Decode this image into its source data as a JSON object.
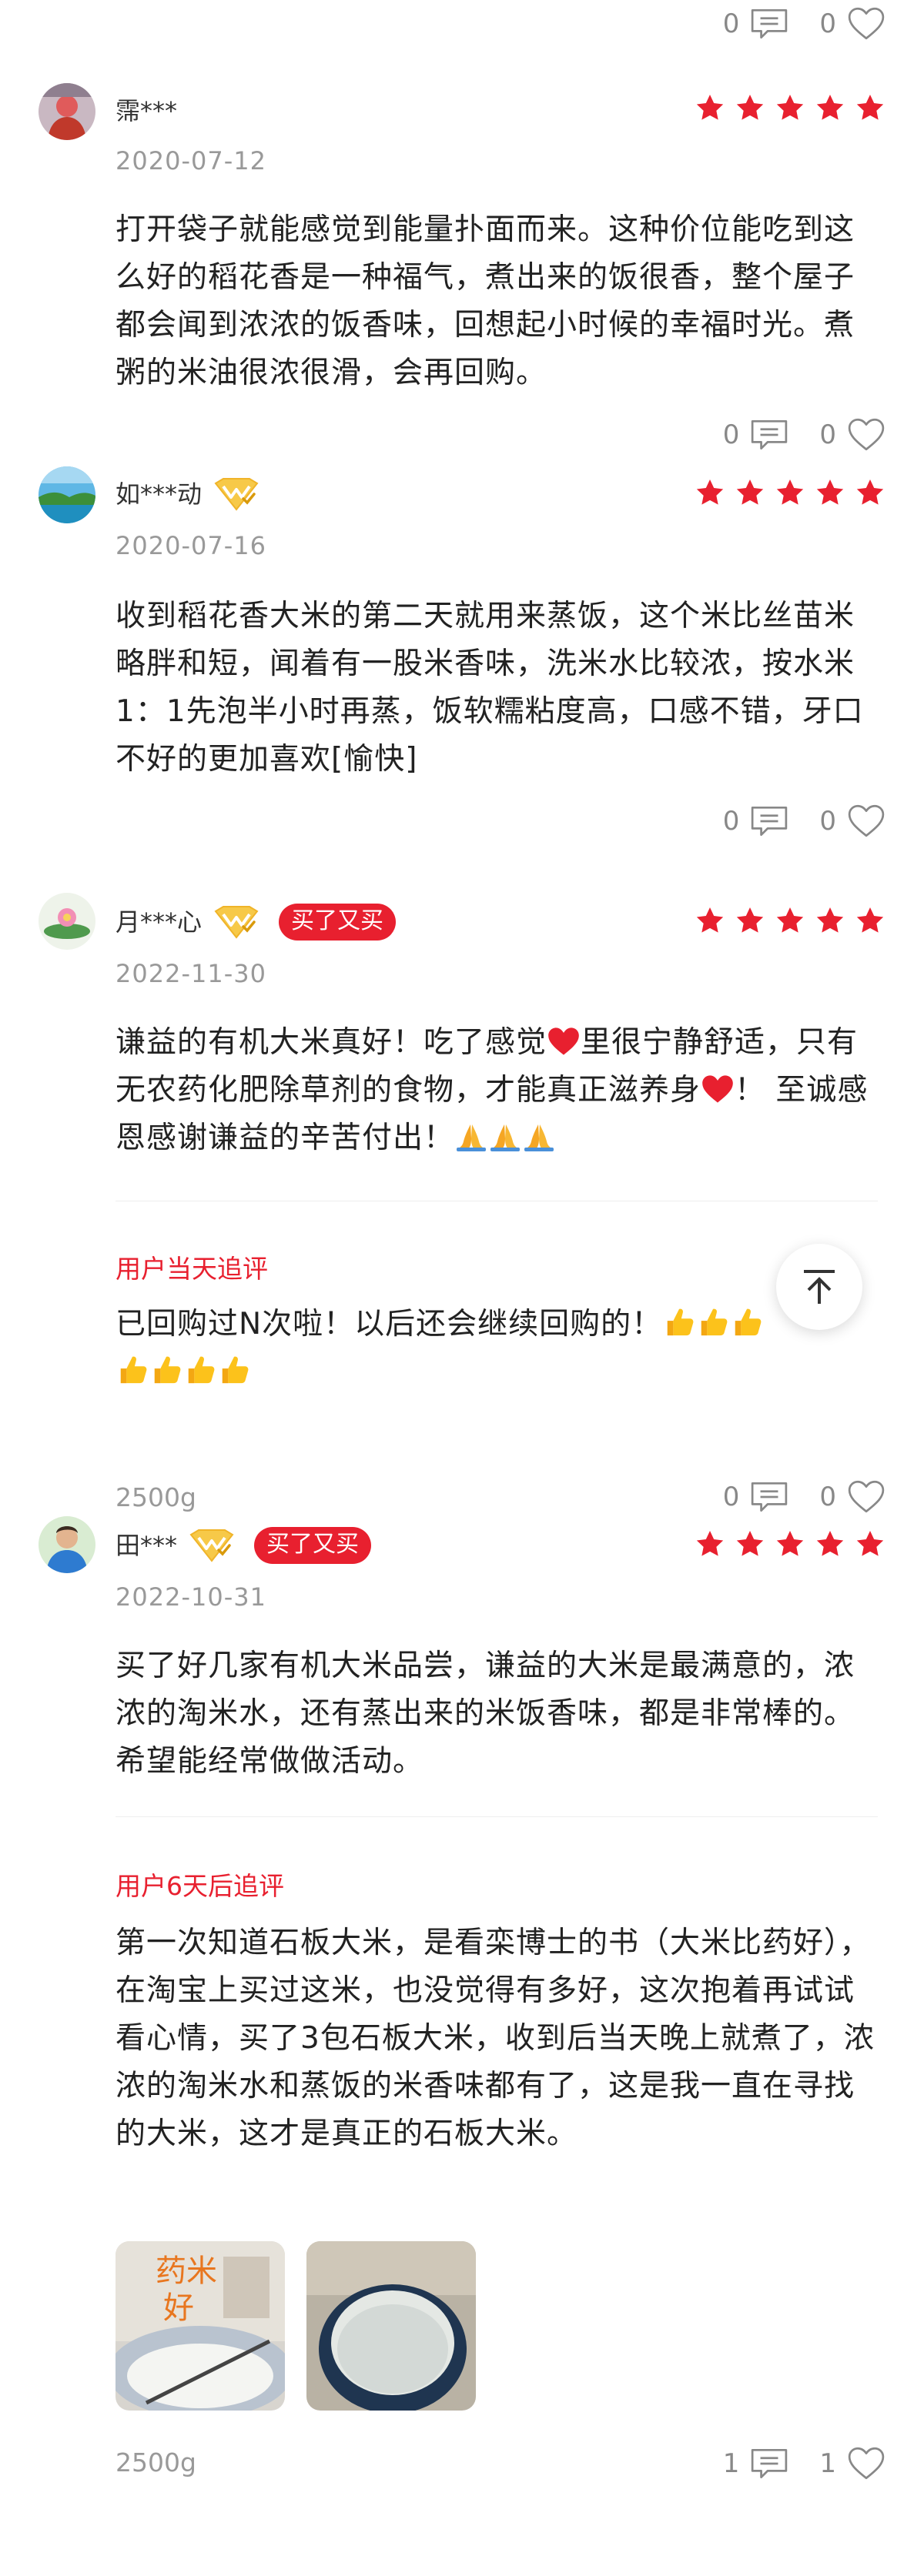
{
  "top_actions": {
    "comments": "0",
    "likes": "0"
  },
  "reviews": [
    {
      "user": "霈***",
      "date": "2020-07-12",
      "content": "打开袋子就能感觉到能量扑面而来。这种价位能吃到这么好的稻花香是一种福气，煮出来的饭很香，整个屋子都会闻到浓浓的饭香味，回想起小时候的幸福时光。煮粥的米油很浓很滑，会再回购。",
      "comments": "0",
      "likes": "0"
    },
    {
      "user": "如***动",
      "date": "2020-07-16",
      "content": "收到稻花香大米的第二天就用来蒸饭，这个米比丝苗米略胖和短，闻着有一股米香味，洗米水比较浓，按水米1：1先泡半小时再蒸，饭软糯粘度高，口感不错，牙口不好的更加喜欢[愉快]",
      "comments": "0",
      "likes": "0"
    },
    {
      "user": "月***心",
      "badge": "买了又买",
      "date": "2022-11-30",
      "content_a": "谦益的有机大米真好！吃了感觉",
      "content_b": "里很宁静舒适，只有无农药化肥除草剂的食物，才能真正滋养身",
      "content_c": "！ 至诚感恩感谢谦益的辛苦付出！",
      "follow_label": "用户当天追评",
      "follow_content": "已回购过N次啦！以后还会继续回购的！",
      "spec": "2500g",
      "comments": "0",
      "likes": "0"
    },
    {
      "user": "田***",
      "badge": "买了又买",
      "date": "2022-10-31",
      "content": "买了好几家有机大米品尝，谦益的大米是最满意的，浓浓的淘米水，还有蒸出来的米饭香味，都是非常棒的。希望能经常做做活动。",
      "follow_label": "用户6天后追评",
      "follow_content": "第一次知道石板大米，是看栾博士的书（大米比药好），在淘宝上买过这米，也没觉得有多好，这次抱着再试试看心情，买了3包石板大米，收到后当天晚上就煮了，浓浓的淘米水和蒸饭的米香味都有了，这是我一直在寻找的大米，这才是真正的石板大米。",
      "photo1_text_a": "药米",
      "photo1_text_b": "好",
      "spec": "2500g",
      "comments": "1",
      "likes": "1"
    }
  ],
  "colors": {
    "accent": "#e8202f",
    "muted": "#999999"
  }
}
